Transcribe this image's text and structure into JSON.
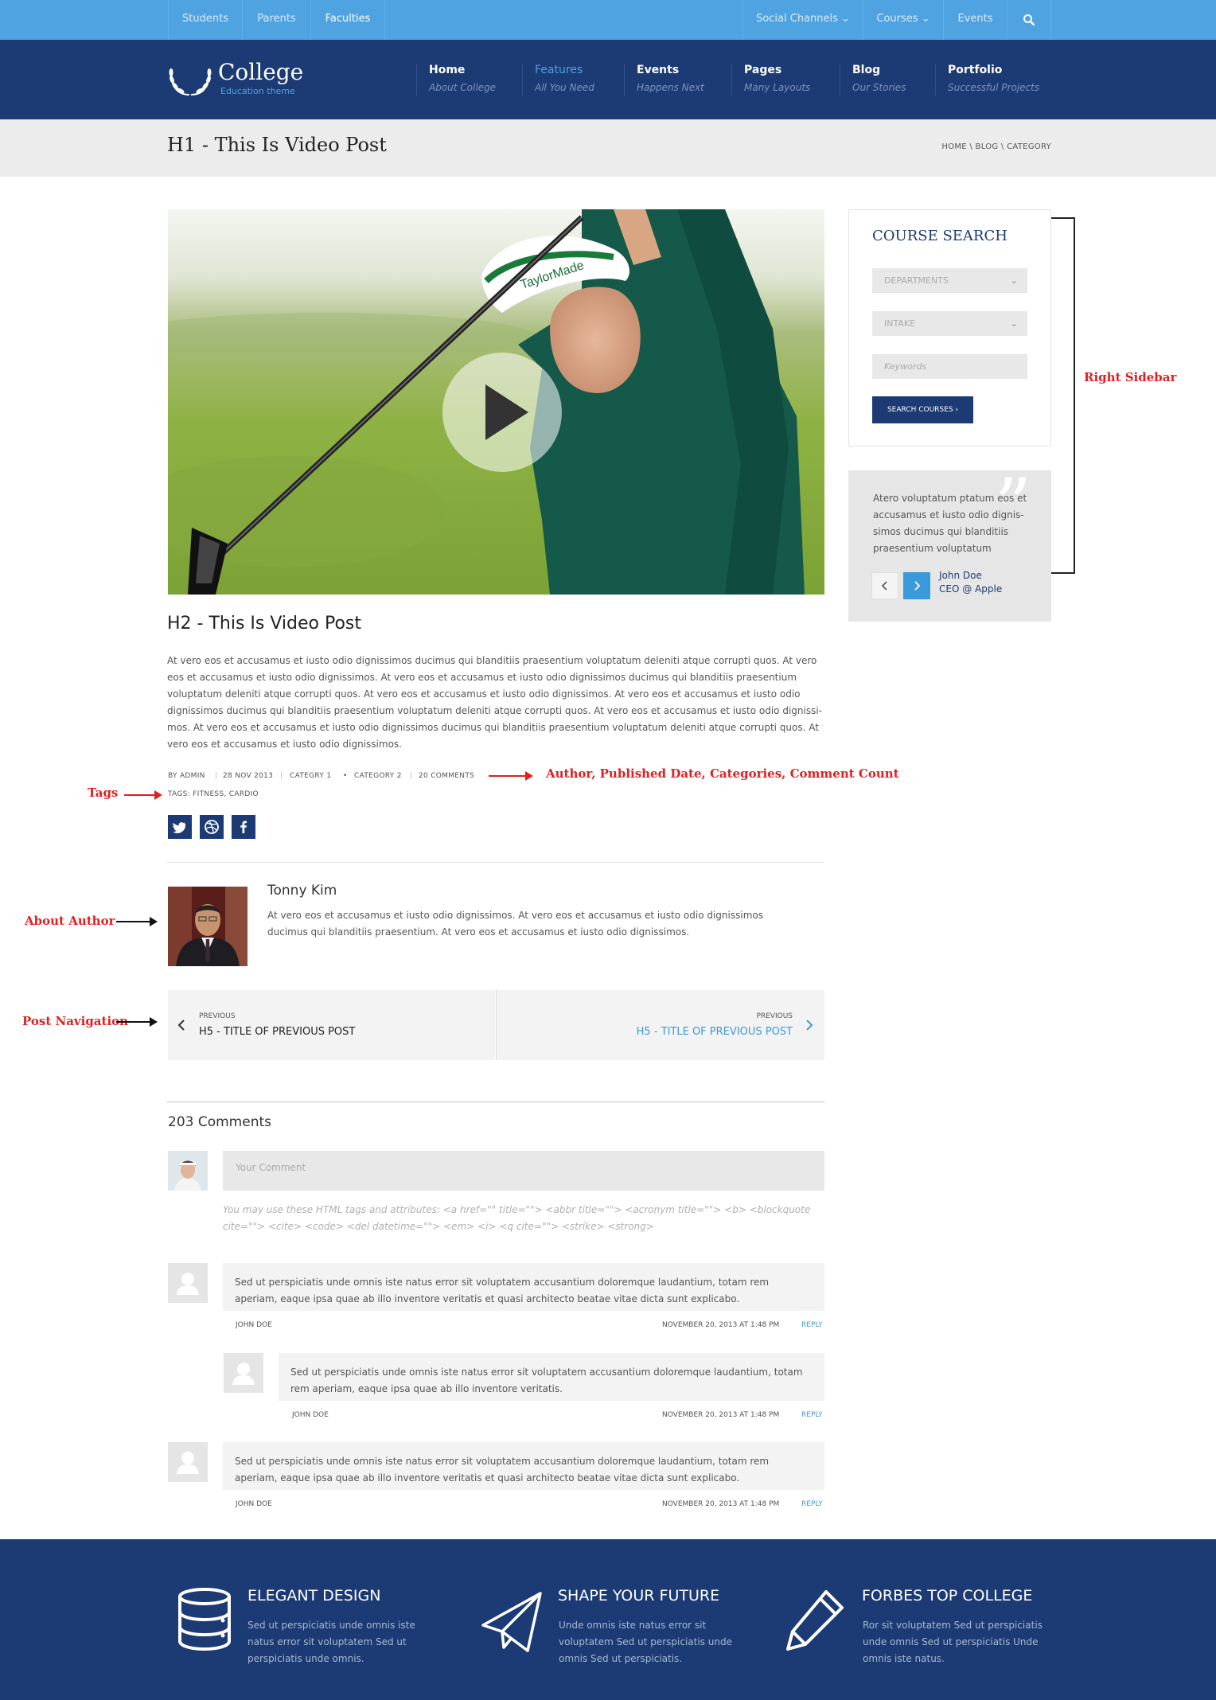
{
  "topbar": {
    "students": "Students",
    "parents": "Parents",
    "faculties": "Faculties",
    "social": "Social Channels",
    "courses": "Courses",
    "events": "Events"
  },
  "logo": {
    "name": "College",
    "tagline": "Education theme"
  },
  "nav": [
    {
      "title": "Home",
      "sub": "About College"
    },
    {
      "title": "Features",
      "sub": "All You Need"
    },
    {
      "title": "Events",
      "sub": "Happens Next"
    },
    {
      "title": "Pages",
      "sub": "Many Layouts"
    },
    {
      "title": "Blog",
      "sub": "Our Stories"
    },
    {
      "title": "Portfolio",
      "sub": "Successful Projects"
    }
  ],
  "page": {
    "h1": "H1 - This Is Video Post",
    "breadcrumb": "HOME \\ BLOG \\ CATEGORY"
  },
  "post": {
    "h2": "H2 - This Is Video Post",
    "body": "At vero eos et accusamus et iusto odio dignissimos ducimus qui blanditiis praesentium voluptatum deleniti atque corrupti quos. At vero eos et accusamus et iusto odio dignissimos. At vero eos et accusamus et iusto odio dignissimos ducimus qui blanditiis praesentium voluptatum deleniti atque corrupti quos. At vero eos et accusamus et iusto odio dignissimos. At vero eos et accusamus et iusto odio dignissimos ducimus qui blanditiis praesentium voluptatum deleniti atque corrupti quos. At vero eos et accusamus et iusto odio dignissi-mos. At vero eos et accusamus et iusto odio dignissimos ducimus qui blanditiis praesentium voluptatum deleniti atque corrupti quos. At vero eos et accusamus et iusto odio dignissimos.",
    "author": "BY ADMIN",
    "date": "28 NOV 2013",
    "cat1": "CATEGRY 1",
    "cat2": "CATEGORY 2",
    "comments": "20 COMMENTS",
    "tags": "TAGS: FITNESS, CARDIO"
  },
  "annotations": {
    "meta": "Author, Published Date, Categories, Comment Count",
    "tags": "Tags",
    "sidebar": "Right Sidebar",
    "author": "About Author",
    "postnav": "Post Navigation"
  },
  "about_author": {
    "name": "Tonny Kim",
    "bio": "At vero eos et accusamus et iusto odio dignissimos. At vero eos et accusamus et iusto odio dignissimos ducimus qui blanditiis praesentium. At vero eos et accusamus et iusto odio dignissimos."
  },
  "post_nav": {
    "prev_label": "PREVIOUS",
    "prev_title": "H5 - TITLE OF PREVIOUS POST",
    "next_label": "PREVIOUS",
    "next_title": "H5 - TITLE OF PREVIOUS POST"
  },
  "comments_section": {
    "count": "203 Comments",
    "placeholder": "Your Comment",
    "allowed_tags": "You may use these HTML tags and attributes: <a href=\"\" title=\"\"> <abbr title=\"\"> <acronym title=\"\"> <b> <blockquote cite=\"\"> <cite> <code> <del datetime=\"\"> <em> <i> <q cite=\"\"> <strike> <strong>",
    "items": [
      {
        "text": "Sed ut perspiciatis unde omnis iste natus error sit voluptatem accusantium doloremque laudantium, totam rem aperiam, eaque ipsa quae ab illo inventore veritatis et quasi architecto beatae vitae dicta sunt explicabo.",
        "author": "JOHN DOE",
        "date": "NOVEMBER 20, 2013 AT 1:48 PM",
        "reply": "REPLY"
      },
      {
        "text": "Sed ut perspiciatis unde omnis iste natus error sit voluptatem accusantium doloremque laudantium, totam rem aperiam, eaque ipsa quae ab illo inventore veritatis.",
        "author": "JOHN DOE",
        "date": "NOVEMBER 20, 2013 AT 1:48 PM",
        "reply": "REPLY"
      },
      {
        "text": "Sed ut perspiciatis unde omnis iste natus error sit voluptatem accusantium doloremque laudantium, totam rem aperiam, eaque ipsa quae ab illo inventore veritatis et quasi architecto beatae vitae dicta sunt explicabo.",
        "author": "JOHN DOE",
        "date": "NOVEMBER 20, 2013 AT 1:48 PM",
        "reply": "REPLY"
      }
    ]
  },
  "sidebar": {
    "title": "COURSE SEARCH",
    "departments": "DEPARTMENTS",
    "intake": "INTAKE",
    "keywords": "Keywords",
    "button": "SEARCH COURSES",
    "quote": "Atero voluptatum ptatum eos et accusamus et iusto odio dignis-simos ducimus qui blanditiis praesentium voluptatum",
    "quote_author": "John Doe",
    "quote_role": "CEO @ Apple"
  },
  "footer": [
    {
      "title": "ELEGANT DESIGN",
      "text": "Sed ut perspiciatis unde omnis iste natus error sit voluptatem Sed ut perspiciatis unde omnis."
    },
    {
      "title": "SHAPE YOUR FUTURE",
      "text": "Unde omnis iste natus error sit voluptatem Sed ut perspiciatis unde omnis Sed ut perspiciatis."
    },
    {
      "title": "FORBES TOP COLLEGE",
      "text": "Ror sit voluptatem Sed ut perspiciatis unde omnis Sed ut perspiciatis Unde omnis iste natus."
    }
  ],
  "colors": {
    "navy": "#1c3a74",
    "sky": "#4fa3e0",
    "accent": "#3b9ad9",
    "annotation": "#e02020"
  }
}
